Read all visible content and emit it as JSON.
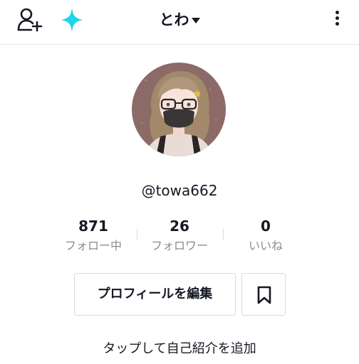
{
  "header": {
    "title": "とわ",
    "accent_color": "#20d5ec",
    "icons": [
      "add-user-icon",
      "sparkle-icon",
      "caret-down-icon",
      "more-vertical-icon"
    ]
  },
  "profile": {
    "handle": "@towa662"
  },
  "stats": [
    {
      "value": "871",
      "label": "フォロー中"
    },
    {
      "value": "26",
      "label": "フォロワー"
    },
    {
      "value": "0",
      "label": "いいね"
    }
  ],
  "actions": {
    "edit_profile_label": "プロフィールを編集",
    "bookmark_icon": "bookmark-icon"
  },
  "bio": {
    "placeholder": "タップして自己紹介を追加"
  }
}
